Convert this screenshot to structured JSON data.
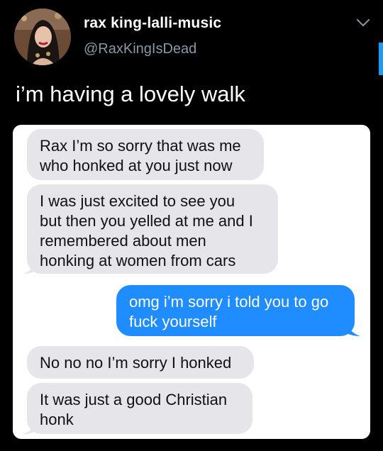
{
  "author": {
    "display_name": "rax king-lalli-music",
    "handle": "@RaxKingIsDead"
  },
  "tweet": {
    "text": "i’m having a lovely walk"
  },
  "messages": [
    {
      "direction": "incoming",
      "text": "Rax I’m so sorry that was me\nwho honked at you just now"
    },
    {
      "direction": "incoming",
      "text": "I was just excited to see you\nbut then you yelled at me and I\nremembered about men\nhonking at women from cars"
    },
    {
      "direction": "outgoing",
      "text": "omg i’m sorry i told you to go\nfuck yourself"
    },
    {
      "direction": "incoming",
      "text": "No no no I’m sorry I honked"
    },
    {
      "direction": "incoming",
      "text": "It was just a good Christian\nhonk"
    }
  ],
  "colors": {
    "background": "#000000",
    "incoming_bubble": "#e5e5ea",
    "outgoing_bubble": "#1f8cff",
    "handle": "#8899a6"
  },
  "icons": {
    "menu": "chevron-down-icon"
  }
}
